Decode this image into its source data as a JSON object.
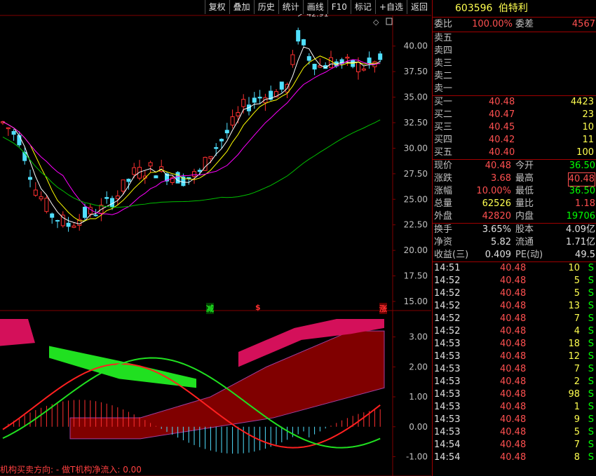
{
  "toolbar": [
    "复权",
    "叠加",
    "历史",
    "统计",
    "画线",
    "F10",
    "标记",
    "+自选",
    "返回"
  ],
  "stock": {
    "code": "603596",
    "name": "伯特利"
  },
  "ratio": {
    "label1": "委比",
    "val1": "100.00%",
    "label2": "委差",
    "val2": "4567"
  },
  "sell": [
    {
      "label": "卖五",
      "price": "",
      "vol": ""
    },
    {
      "label": "卖四",
      "price": "",
      "vol": ""
    },
    {
      "label": "卖三",
      "price": "",
      "vol": ""
    },
    {
      "label": "卖二",
      "price": "",
      "vol": ""
    },
    {
      "label": "卖一",
      "price": "",
      "vol": ""
    }
  ],
  "buy": [
    {
      "label": "买一",
      "price": "40.48",
      "vol": "4423"
    },
    {
      "label": "买二",
      "price": "40.47",
      "vol": "23"
    },
    {
      "label": "买三",
      "price": "40.45",
      "vol": "10"
    },
    {
      "label": "买四",
      "price": "40.42",
      "vol": "11"
    },
    {
      "label": "买五",
      "price": "40.40",
      "vol": "100"
    }
  ],
  "stats": [
    {
      "l1": "现价",
      "v1": "40.48",
      "c1": "red",
      "l2": "今开",
      "v2": "36.50",
      "c2": "green"
    },
    {
      "l1": "涨跌",
      "v1": "3.68",
      "c1": "red",
      "l2": "最高",
      "v2": "40.48",
      "c2": "red"
    },
    {
      "l1": "涨幅",
      "v1": "10.00%",
      "c1": "red",
      "l2": "最低",
      "v2": "36.50",
      "c2": "green"
    },
    {
      "l1": "总量",
      "v1": "62526",
      "c1": "yellow",
      "l2": "量比",
      "v2": "1.18",
      "c2": "red"
    },
    {
      "l1": "外盘",
      "v1": "42820",
      "c1": "red",
      "l2": "内盘",
      "v2": "19706",
      "c2": "green"
    }
  ],
  "fund": [
    {
      "l1": "换手",
      "v1": "3.65%",
      "l2": "股本",
      "v2": "4.09亿"
    },
    {
      "l1": "净资",
      "v1": "5.82",
      "l2": "流通",
      "v2": "1.71亿"
    },
    {
      "l1": "收益(三)",
      "v1": "0.409",
      "l2": "PE(动)",
      "v2": "49.5"
    }
  ],
  "ticks": [
    {
      "time": "14:51",
      "price": "40.48",
      "vol": "10",
      "flag": "S"
    },
    {
      "time": "14:52",
      "price": "40.48",
      "vol": "5",
      "flag": "S"
    },
    {
      "time": "14:52",
      "price": "40.48",
      "vol": "5",
      "flag": "S"
    },
    {
      "time": "14:52",
      "price": "40.48",
      "vol": "13",
      "flag": "S"
    },
    {
      "time": "14:52",
      "price": "40.48",
      "vol": "7",
      "flag": "S"
    },
    {
      "time": "14:52",
      "price": "40.48",
      "vol": "4",
      "flag": "S"
    },
    {
      "time": "14:53",
      "price": "40.48",
      "vol": "18",
      "flag": "S"
    },
    {
      "time": "14:53",
      "price": "40.48",
      "vol": "12",
      "flag": "S"
    },
    {
      "time": "14:53",
      "price": "40.48",
      "vol": "7",
      "flag": "S"
    },
    {
      "time": "14:53",
      "price": "40.48",
      "vol": "2",
      "flag": "S"
    },
    {
      "time": "14:53",
      "price": "40.48",
      "vol": "98",
      "flag": "S"
    },
    {
      "time": "14:53",
      "price": "40.48",
      "vol": "1",
      "flag": "S"
    },
    {
      "time": "14:53",
      "price": "40.48",
      "vol": "9",
      "flag": "S"
    },
    {
      "time": "14:53",
      "price": "40.48",
      "vol": "5",
      "flag": "S"
    },
    {
      "time": "14:54",
      "price": "40.48",
      "vol": "7",
      "flag": "S"
    },
    {
      "time": "14:54",
      "price": "40.48",
      "vol": "8",
      "flag": "S"
    }
  ],
  "chart": {
    "high_label": "42.91",
    "y_ticks": [
      "40.00",
      "37.50",
      "35.00",
      "32.50",
      "30.00",
      "27.50",
      "25.00",
      "22.50",
      "20.00",
      "17.50",
      "15.00"
    ],
    "ind_ticks": [
      "3.00",
      "2.00",
      "1.00",
      "0.00",
      "-1.00"
    ],
    "stamp_reduce": "减",
    "stamp_s": "$",
    "stamp_rise": "涨",
    "bottom_label": "机构买卖方向: - 做T机构净流入: 0.00",
    "colors": {
      "up": "#ff3030",
      "down": "#50e0ff",
      "ma5": "#ffffff",
      "ma10": "#ffff00",
      "ma20": "#ff00ff",
      "ma60": "#00c000",
      "grid": "#800000",
      "ribbon": "#d4105a",
      "ribbon_green": "#20e020",
      "cloud": "#800000"
    }
  },
  "chart_data": {
    "type": "candlestick",
    "ylim": [
      15,
      43
    ],
    "high": 42.91,
    "indicator_ylim": [
      -1.2,
      3.6
    ]
  }
}
